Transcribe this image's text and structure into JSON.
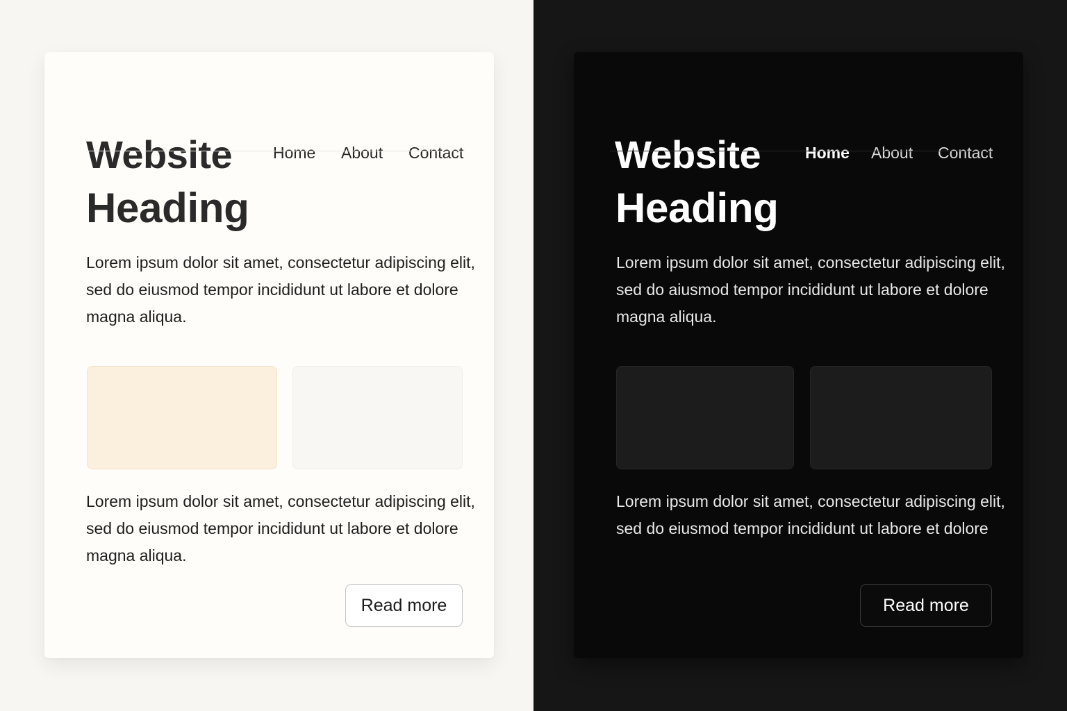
{
  "light": {
    "brand": "Website",
    "nav": {
      "home": "Home",
      "about": "About",
      "contact": "Contact"
    },
    "heading": "Heading",
    "paragraph1": "Lorem ipsum dolor sit amet, consectetur adipiscing elit, sed do eiusmod tempor incididunt ut labore et dolore magna aliqua.",
    "paragraph2": "Lorem ipsum dolor sit amet, consectetur adipiscing elit, sed do eiusmod tempor incididunt ut labore et dolore magna aliqua.",
    "button": "Read more"
  },
  "dark": {
    "brand": "Website",
    "nav": {
      "home": "Home",
      "about": "About",
      "contact": "Contact",
      "active": "Home"
    },
    "heading": "Heading",
    "paragraph1": "Lorem ipsum dolor sit amet, consectetur adipiscing elit, sed do aiusmod tempor incididunt ut labore et dolore magna aliqua.",
    "paragraph2": "Lorem ipsum dolor sit amet, consectetur adipiscing elit, sed do eiusmod tempor incididunt ut labore et dolore",
    "button": "Read more"
  },
  "colors": {
    "light_background": "#f7f6f3",
    "light_card": "#fefdf9",
    "light_tile_warm": "#fbf0de",
    "light_tile_neutral": "#f8f7f4",
    "dark_background": "#161616",
    "dark_card": "#090909",
    "dark_tile": "#1c1c1c"
  }
}
